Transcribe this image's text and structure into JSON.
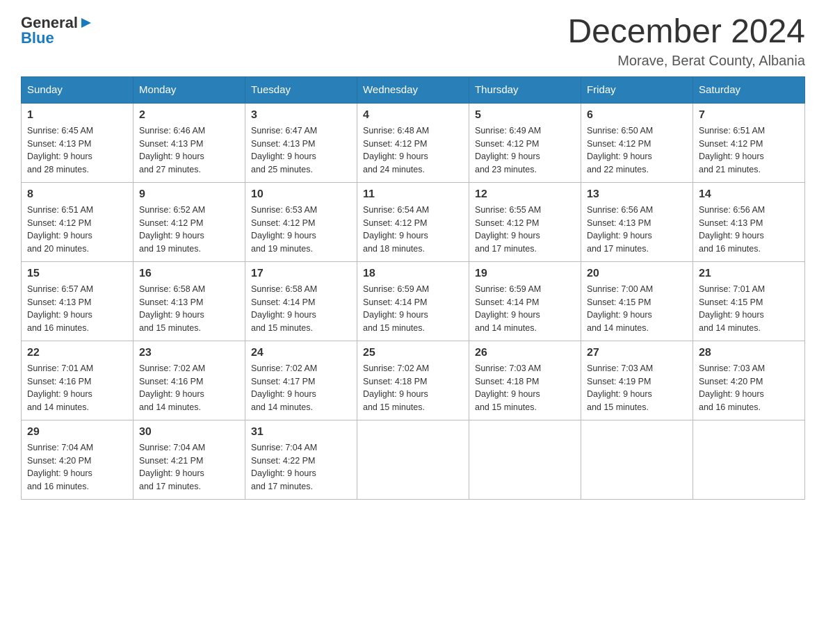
{
  "header": {
    "logo_general": "General",
    "logo_blue": "Blue",
    "month_title": "December 2024",
    "location": "Morave, Berat County, Albania"
  },
  "weekdays": [
    "Sunday",
    "Monday",
    "Tuesday",
    "Wednesday",
    "Thursday",
    "Friday",
    "Saturday"
  ],
  "weeks": [
    [
      {
        "day": "1",
        "sunrise": "6:45 AM",
        "sunset": "4:13 PM",
        "daylight": "9 hours and 28 minutes."
      },
      {
        "day": "2",
        "sunrise": "6:46 AM",
        "sunset": "4:13 PM",
        "daylight": "9 hours and 27 minutes."
      },
      {
        "day": "3",
        "sunrise": "6:47 AM",
        "sunset": "4:13 PM",
        "daylight": "9 hours and 25 minutes."
      },
      {
        "day": "4",
        "sunrise": "6:48 AM",
        "sunset": "4:12 PM",
        "daylight": "9 hours and 24 minutes."
      },
      {
        "day": "5",
        "sunrise": "6:49 AM",
        "sunset": "4:12 PM",
        "daylight": "9 hours and 23 minutes."
      },
      {
        "day": "6",
        "sunrise": "6:50 AM",
        "sunset": "4:12 PM",
        "daylight": "9 hours and 22 minutes."
      },
      {
        "day": "7",
        "sunrise": "6:51 AM",
        "sunset": "4:12 PM",
        "daylight": "9 hours and 21 minutes."
      }
    ],
    [
      {
        "day": "8",
        "sunrise": "6:51 AM",
        "sunset": "4:12 PM",
        "daylight": "9 hours and 20 minutes."
      },
      {
        "day": "9",
        "sunrise": "6:52 AM",
        "sunset": "4:12 PM",
        "daylight": "9 hours and 19 minutes."
      },
      {
        "day": "10",
        "sunrise": "6:53 AM",
        "sunset": "4:12 PM",
        "daylight": "9 hours and 19 minutes."
      },
      {
        "day": "11",
        "sunrise": "6:54 AM",
        "sunset": "4:12 PM",
        "daylight": "9 hours and 18 minutes."
      },
      {
        "day": "12",
        "sunrise": "6:55 AM",
        "sunset": "4:12 PM",
        "daylight": "9 hours and 17 minutes."
      },
      {
        "day": "13",
        "sunrise": "6:56 AM",
        "sunset": "4:13 PM",
        "daylight": "9 hours and 17 minutes."
      },
      {
        "day": "14",
        "sunrise": "6:56 AM",
        "sunset": "4:13 PM",
        "daylight": "9 hours and 16 minutes."
      }
    ],
    [
      {
        "day": "15",
        "sunrise": "6:57 AM",
        "sunset": "4:13 PM",
        "daylight": "9 hours and 16 minutes."
      },
      {
        "day": "16",
        "sunrise": "6:58 AM",
        "sunset": "4:13 PM",
        "daylight": "9 hours and 15 minutes."
      },
      {
        "day": "17",
        "sunrise": "6:58 AM",
        "sunset": "4:14 PM",
        "daylight": "9 hours and 15 minutes."
      },
      {
        "day": "18",
        "sunrise": "6:59 AM",
        "sunset": "4:14 PM",
        "daylight": "9 hours and 15 minutes."
      },
      {
        "day": "19",
        "sunrise": "6:59 AM",
        "sunset": "4:14 PM",
        "daylight": "9 hours and 14 minutes."
      },
      {
        "day": "20",
        "sunrise": "7:00 AM",
        "sunset": "4:15 PM",
        "daylight": "9 hours and 14 minutes."
      },
      {
        "day": "21",
        "sunrise": "7:01 AM",
        "sunset": "4:15 PM",
        "daylight": "9 hours and 14 minutes."
      }
    ],
    [
      {
        "day": "22",
        "sunrise": "7:01 AM",
        "sunset": "4:16 PM",
        "daylight": "9 hours and 14 minutes."
      },
      {
        "day": "23",
        "sunrise": "7:02 AM",
        "sunset": "4:16 PM",
        "daylight": "9 hours and 14 minutes."
      },
      {
        "day": "24",
        "sunrise": "7:02 AM",
        "sunset": "4:17 PM",
        "daylight": "9 hours and 14 minutes."
      },
      {
        "day": "25",
        "sunrise": "7:02 AM",
        "sunset": "4:18 PM",
        "daylight": "9 hours and 15 minutes."
      },
      {
        "day": "26",
        "sunrise": "7:03 AM",
        "sunset": "4:18 PM",
        "daylight": "9 hours and 15 minutes."
      },
      {
        "day": "27",
        "sunrise": "7:03 AM",
        "sunset": "4:19 PM",
        "daylight": "9 hours and 15 minutes."
      },
      {
        "day": "28",
        "sunrise": "7:03 AM",
        "sunset": "4:20 PM",
        "daylight": "9 hours and 16 minutes."
      }
    ],
    [
      {
        "day": "29",
        "sunrise": "7:04 AM",
        "sunset": "4:20 PM",
        "daylight": "9 hours and 16 minutes."
      },
      {
        "day": "30",
        "sunrise": "7:04 AM",
        "sunset": "4:21 PM",
        "daylight": "9 hours and 17 minutes."
      },
      {
        "day": "31",
        "sunrise": "7:04 AM",
        "sunset": "4:22 PM",
        "daylight": "9 hours and 17 minutes."
      },
      null,
      null,
      null,
      null
    ]
  ],
  "labels": {
    "sunrise": "Sunrise:",
    "sunset": "Sunset:",
    "daylight": "Daylight:"
  }
}
